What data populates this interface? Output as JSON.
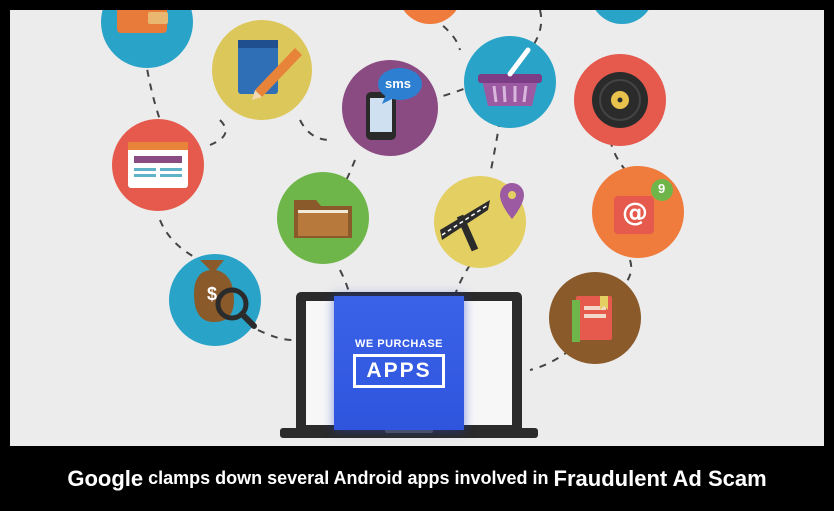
{
  "brand": {
    "line1": "WE PURCHASE",
    "line2": "APPS"
  },
  "caption": {
    "part1": "Google",
    "part2": "clamps down several Android apps involved in",
    "part3": "Fraudulent Ad Scam"
  },
  "icons": [
    "wallet-icon",
    "notepad-pencil-icon",
    "sms-phone-icon",
    "shopping-basket-icon",
    "vinyl-record-icon",
    "browser-window-icon",
    "folder-icon",
    "map-pin-icon",
    "email-notification-icon",
    "money-bag-search-icon",
    "book-icon"
  ],
  "badges": {
    "sms": "sms",
    "notification_count": "9",
    "dollar": "$",
    "at": "@"
  },
  "colors": {
    "brand_blue": "#2f55de",
    "frame": "#000000",
    "background": "#ececec"
  }
}
